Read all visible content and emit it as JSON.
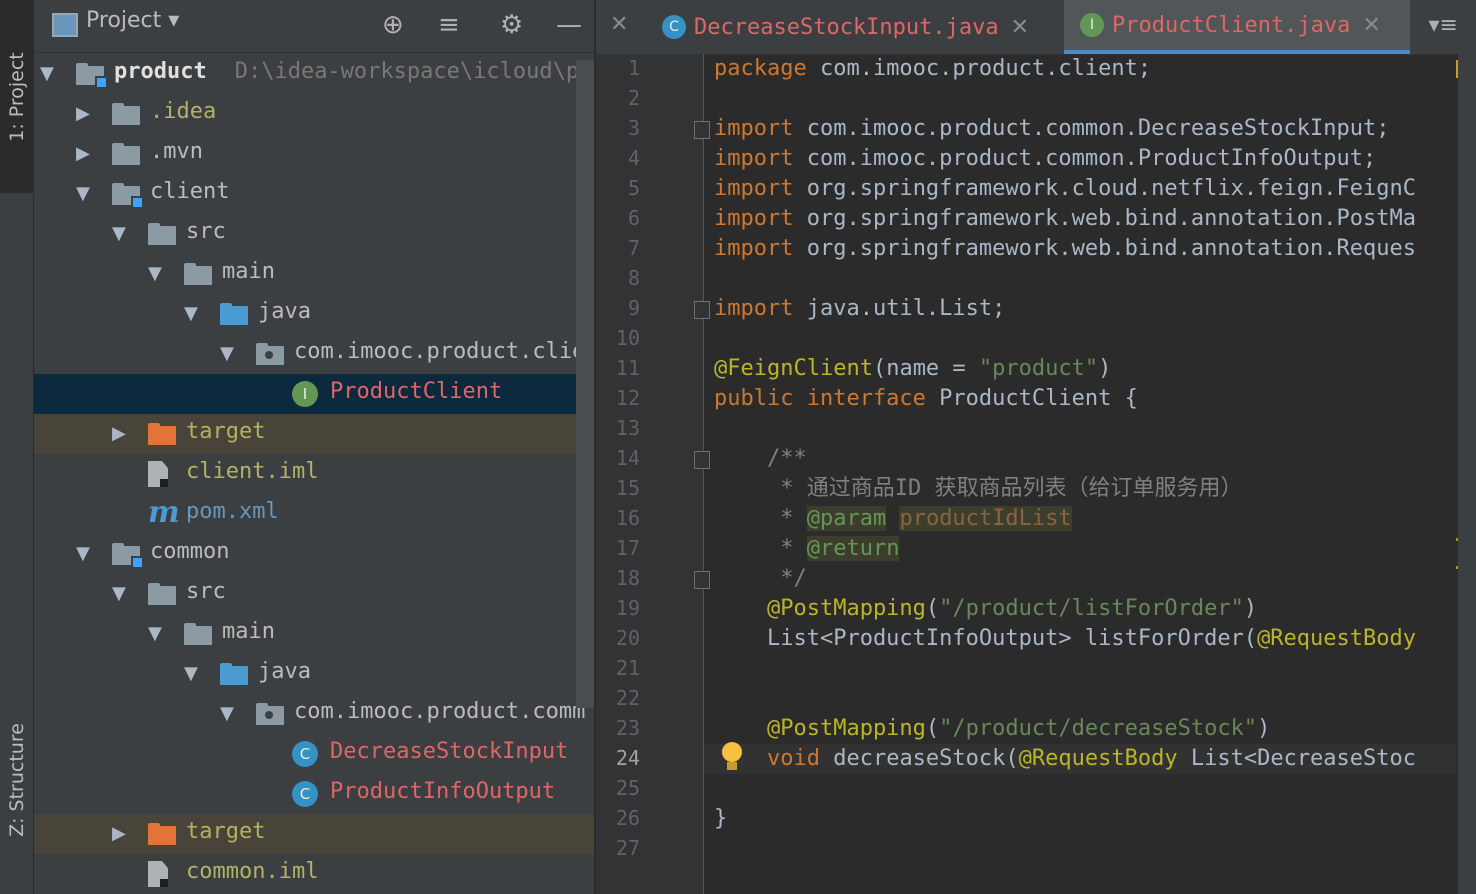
{
  "tool_window_tabs": [
    {
      "id": "project",
      "label": "1: Project"
    },
    {
      "id": "structure",
      "label": "Z: Structure"
    }
  ],
  "project_panel": {
    "title": "Project",
    "header_icons": [
      "locate-icon",
      "collapse-all-icon",
      "settings-gear-icon",
      "hide-icon"
    ],
    "tree": [
      {
        "label": "product",
        "path": "D:\\idea-workspace\\icloud\\p",
        "indent": 0,
        "expanded": true,
        "icon": "module-folder",
        "style": "bold"
      },
      {
        "label": ".idea",
        "indent": 1,
        "expanded": false,
        "icon": "folder-grey",
        "style": "ignored"
      },
      {
        "label": ".mvn",
        "indent": 1,
        "expanded": false,
        "icon": "folder-grey",
        "style": "default"
      },
      {
        "label": "client",
        "indent": 1,
        "expanded": true,
        "icon": "module-folder",
        "style": "default"
      },
      {
        "label": "src",
        "indent": 2,
        "expanded": true,
        "icon": "folder-grey",
        "style": "default"
      },
      {
        "label": "main",
        "indent": 3,
        "expanded": true,
        "icon": "folder-grey",
        "style": "default"
      },
      {
        "label": "java",
        "indent": 4,
        "expanded": true,
        "icon": "folder-blue",
        "style": "default"
      },
      {
        "label": "com.imooc.product.clie",
        "indent": 5,
        "expanded": true,
        "icon": "package",
        "style": "default"
      },
      {
        "label": "ProductClient",
        "indent": 6,
        "icon": "interface",
        "style": "red",
        "selected": true
      },
      {
        "label": "target",
        "indent": 2,
        "expanded": false,
        "icon": "folder-orange",
        "style": "ignored",
        "excluded": true
      },
      {
        "label": "client.iml",
        "indent": 2,
        "icon": "iml-file",
        "style": "ignored"
      },
      {
        "label": "pom.xml",
        "indent": 2,
        "icon": "maven",
        "style": "blue"
      },
      {
        "label": "common",
        "indent": 1,
        "expanded": true,
        "icon": "module-folder",
        "style": "default"
      },
      {
        "label": "src",
        "indent": 2,
        "expanded": true,
        "icon": "folder-grey",
        "style": "default"
      },
      {
        "label": "main",
        "indent": 3,
        "expanded": true,
        "icon": "folder-grey",
        "style": "default"
      },
      {
        "label": "java",
        "indent": 4,
        "expanded": true,
        "icon": "folder-blue",
        "style": "default"
      },
      {
        "label": "com.imooc.product.comm",
        "indent": 5,
        "expanded": true,
        "icon": "package",
        "style": "default"
      },
      {
        "label": "DecreaseStockInput",
        "indent": 6,
        "icon": "class",
        "style": "red"
      },
      {
        "label": "ProductInfoOutput",
        "indent": 6,
        "icon": "class",
        "style": "red"
      },
      {
        "label": "target",
        "indent": 2,
        "expanded": false,
        "icon": "folder-orange",
        "style": "ignored",
        "excluded": true
      },
      {
        "label": "common.iml",
        "indent": 2,
        "icon": "iml-file",
        "style": "ignored"
      }
    ]
  },
  "editor": {
    "tabs": [
      {
        "label": "DecreaseStockInput.java",
        "kind": "class",
        "active": false
      },
      {
        "label": "ProductClient.java",
        "kind": "interface",
        "active": true
      }
    ],
    "current_line": 24,
    "code_lines": [
      [
        [
          "kw",
          "package"
        ],
        [
          "t",
          " com.imooc.product.client;"
        ]
      ],
      [],
      [
        [
          "kw",
          "import"
        ],
        [
          "t",
          " com.imooc.product.common.DecreaseStockInput;"
        ]
      ],
      [
        [
          "kw",
          "import"
        ],
        [
          "t",
          " com.imooc.product.common.ProductInfoOutput;"
        ]
      ],
      [
        [
          "kw",
          "import"
        ],
        [
          "t",
          " org.springframework.cloud.netflix.feign.FeignC"
        ]
      ],
      [
        [
          "kw",
          "import"
        ],
        [
          "t",
          " org.springframework.web.bind.annotation.PostMa"
        ]
      ],
      [
        [
          "kw",
          "import"
        ],
        [
          "t",
          " org.springframework.web.bind.annotation.Reques"
        ]
      ],
      [],
      [
        [
          "kw",
          "import"
        ],
        [
          "t",
          " java.util.List;"
        ]
      ],
      [],
      [
        [
          "ann",
          "@FeignClient"
        ],
        [
          "t",
          "(name = "
        ],
        [
          "str",
          "\"product\""
        ],
        [
          "t",
          ")"
        ]
      ],
      [
        [
          "kw",
          "public interface"
        ],
        [
          "t",
          " ProductClient {"
        ]
      ],
      [],
      [
        [
          "cmt",
          "    /**"
        ]
      ],
      [
        [
          "cmt",
          "     * 通过商品ID 获取商品列表（给订单服务用）"
        ]
      ],
      [
        [
          "cmt",
          "     * "
        ],
        [
          "doctag",
          "@param"
        ],
        [
          "cmt",
          " "
        ],
        [
          "docval",
          "productIdList"
        ]
      ],
      [
        [
          "cmt",
          "     * "
        ],
        [
          "doctag",
          "@return"
        ]
      ],
      [
        [
          "cmt",
          "     */"
        ]
      ],
      [
        [
          "ann",
          "    @PostMapping"
        ],
        [
          "t",
          "("
        ],
        [
          "str",
          "\"/product/listForOrder\""
        ],
        [
          "t",
          ")"
        ]
      ],
      [
        [
          "t",
          "    List<ProductInfoOutput> listForOrder("
        ],
        [
          "ann",
          "@RequestBody"
        ]
      ],
      [],
      [],
      [
        [
          "ann",
          "    @PostMapping"
        ],
        [
          "t",
          "("
        ],
        [
          "str",
          "\"/product/decreaseStock\""
        ],
        [
          "t",
          ")"
        ]
      ],
      [
        [
          "kw",
          "    void"
        ],
        [
          "t",
          " decreaseStock("
        ],
        [
          "ann",
          "@RequestBody"
        ],
        [
          "t",
          " List<DecreaseStoc"
        ]
      ],
      [],
      [
        [
          "t",
          "}"
        ]
      ],
      []
    ]
  }
}
